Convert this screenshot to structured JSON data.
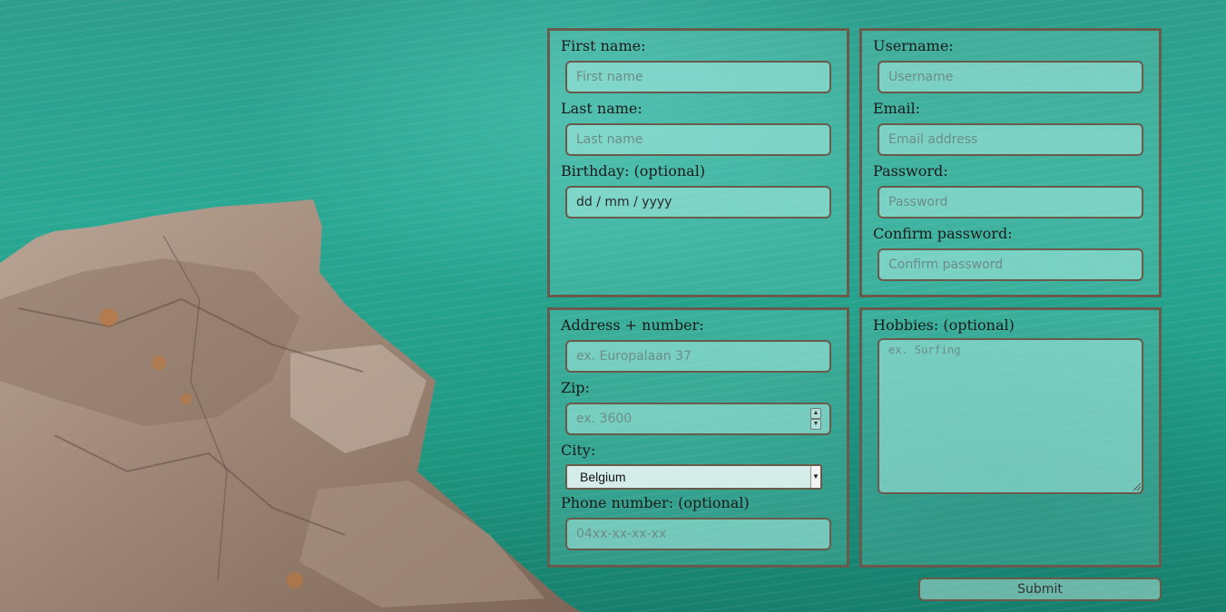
{
  "personal": {
    "first_name": {
      "label": "First name:",
      "placeholder": "First name"
    },
    "last_name": {
      "label": "Last name:",
      "placeholder": "Last name"
    },
    "birthday": {
      "label": "Birthday: (optional)",
      "value": "dd / mm / yyyy"
    }
  },
  "account": {
    "username": {
      "label": "Username:",
      "placeholder": "Username"
    },
    "email": {
      "label": "Email:",
      "placeholder": "Email address"
    },
    "password": {
      "label": "Password:",
      "placeholder": "Password"
    },
    "confirm": {
      "label": "Confirm password:",
      "placeholder": "Confirm password"
    }
  },
  "address": {
    "street": {
      "label": "Address + number:",
      "placeholder": "ex. Europalaan 37"
    },
    "zip": {
      "label": "Zip:",
      "placeholder": "ex. 3600"
    },
    "city": {
      "label": "City:",
      "selected": "Belgium"
    },
    "phone": {
      "label": "Phone number: (optional)",
      "placeholder": "04xx-xx-xx-xx"
    }
  },
  "hobbies": {
    "label": "Hobbies: (optional)",
    "placeholder": "ex. Surfing"
  },
  "submit_label": "Submit",
  "colors": {
    "border": "#6a5a4c",
    "water": "#2aa893",
    "field_bg": "#aaebe1"
  },
  "icons": {
    "spinner": "spinner-arrows-icon",
    "select_caret": "caret-down-icon",
    "resize": "resize-grip-icon"
  }
}
